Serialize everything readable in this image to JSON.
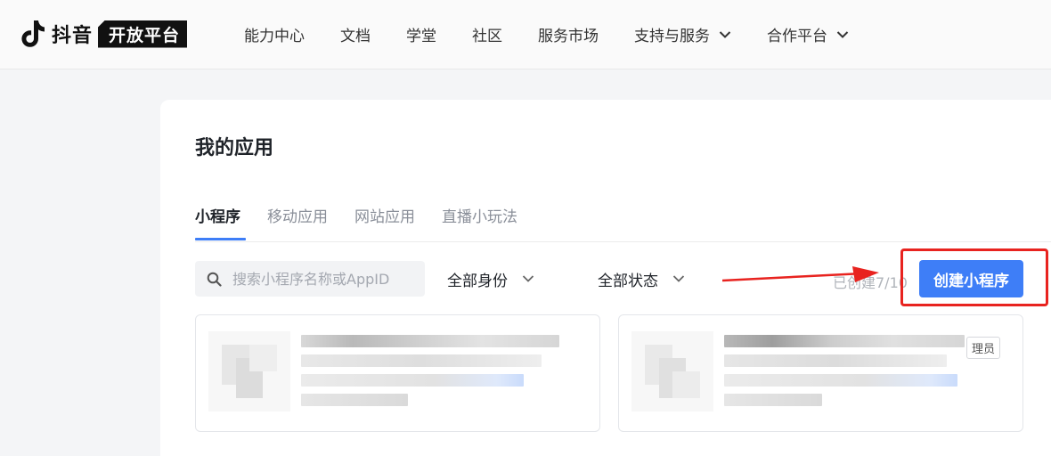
{
  "brand": {
    "word": "抖音",
    "badge": "开放平台"
  },
  "nav": [
    {
      "label": "能力中心",
      "dropdown": false
    },
    {
      "label": "文档",
      "dropdown": false
    },
    {
      "label": "学堂",
      "dropdown": false
    },
    {
      "label": "社区",
      "dropdown": false
    },
    {
      "label": "服务市场",
      "dropdown": false
    },
    {
      "label": "支持与服务",
      "dropdown": true
    },
    {
      "label": "合作平台",
      "dropdown": true
    }
  ],
  "page": {
    "title": "我的应用"
  },
  "tabs": [
    {
      "label": "小程序",
      "active": true
    },
    {
      "label": "移动应用",
      "active": false
    },
    {
      "label": "网站应用",
      "active": false
    },
    {
      "label": "直播小玩法",
      "active": false
    }
  ],
  "filters": {
    "search_placeholder": "搜索小程序名称或AppID",
    "identity_select": "全部身份",
    "status_select": "全部状态"
  },
  "quota_text": "已创建7/10",
  "create_button": "创建小程序",
  "app_cards": [
    {
      "role_tag": ""
    },
    {
      "role_tag": "理员"
    }
  ],
  "colors": {
    "accent": "#3e7ef7",
    "highlight": "#e8231f"
  }
}
